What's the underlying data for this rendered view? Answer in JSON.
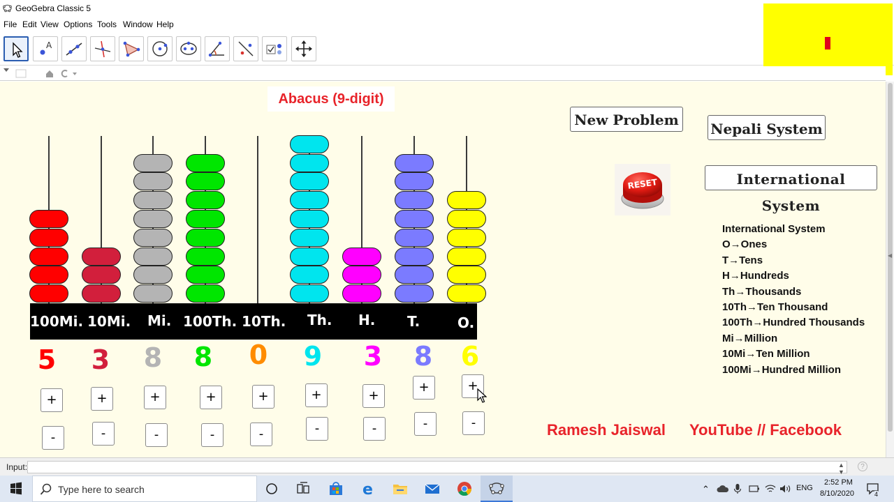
{
  "window": {
    "title": "GeoGebra Classic 5"
  },
  "menu": [
    "File",
    "Edit",
    "View",
    "Options",
    "Tools",
    "Window",
    "Help"
  ],
  "toolbar": {
    "tools": [
      "move-tool",
      "point-tool",
      "line-tool",
      "perpendicular-line-tool",
      "polygon-tool",
      "circle-tool",
      "conic-tool",
      "angle-tool",
      "reflect-tool",
      "slider-checkbox-tool",
      "move-graphics-view-tool"
    ]
  },
  "page": {
    "title": "Abacus (9-digit)",
    "new_problem": "New Problem",
    "nepali_system": "Nepali System",
    "international_system": "International System",
    "reset": "RESET"
  },
  "abacus": {
    "columns": [
      {
        "label": "100Mi.",
        "value": "5",
        "color": "#ff0000",
        "beads": 5
      },
      {
        "label": "10Mi.",
        "value": "3",
        "color": "#d21f3c",
        "beads": 3
      },
      {
        "label": "Mi.",
        "value": "8",
        "color": "#b4b4b4",
        "beads": 8
      },
      {
        "label": "100Th.",
        "value": "8",
        "color": "#00e600",
        "beads": 8
      },
      {
        "label": "10Th.",
        "value": "0",
        "color": "#ff8c00",
        "beads": 0
      },
      {
        "label": "Th.",
        "value": "9",
        "color": "#00e5ee",
        "beads": 9
      },
      {
        "label": "H.",
        "value": "3",
        "color": "#ff00ff",
        "beads": 3
      },
      {
        "label": "T.",
        "value": "8",
        "color": "#7b7bff",
        "beads": 8
      },
      {
        "label": "O.",
        "value": "6",
        "color": "#ffff00",
        "beads": 6
      }
    ],
    "plus_label": "+",
    "minus_label": "-"
  },
  "legend": [
    "International System",
    "O→Ones",
    "T→Tens",
    "H→Hundreds",
    "Th→Thousands",
    "10Th→Ten Thousand",
    "100Th→Hundred Thousands",
    "Mi→Million",
    "10Mi→Ten Million",
    "100Mi→Hundred Million"
  ],
  "credit": {
    "author": "Ramesh  Jaiswal",
    "channels": "YouTube //  Facebook"
  },
  "input_bar": {
    "label": "Input:",
    "value": ""
  },
  "taskbar": {
    "search_placeholder": "Type here to search",
    "language": "ENG",
    "time": "2:52 PM",
    "date": "8/10/2020",
    "notifications": "4"
  }
}
